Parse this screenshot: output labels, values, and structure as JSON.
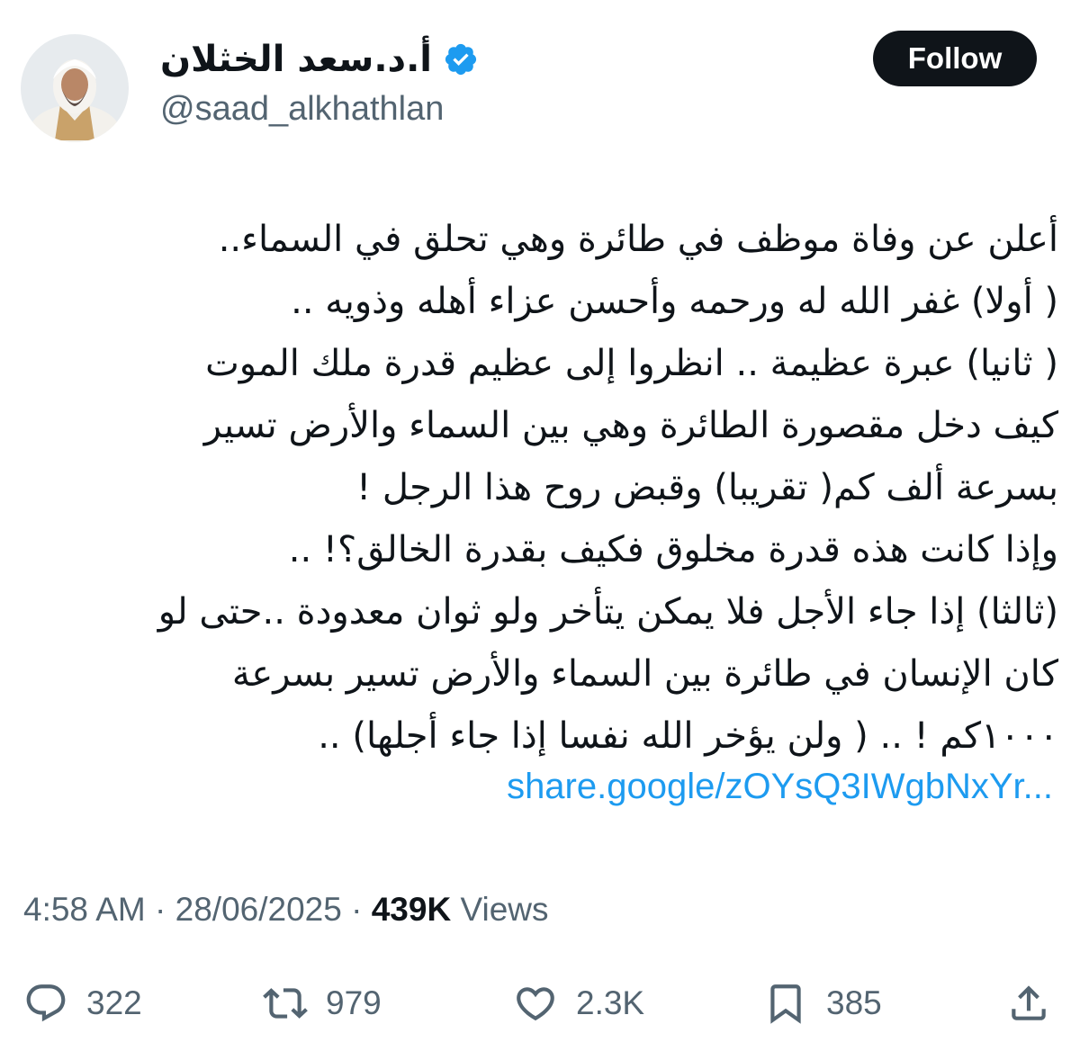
{
  "author": {
    "display_name": "أ.د.سعد الخثلان",
    "handle": "@saad_alkhathlan",
    "verified": true
  },
  "follow_button_label": "Follow",
  "tweet": {
    "lines": [
      "أعلن عن وفاة موظف في طائرة وهي تحلق في السماء..",
      "( أولا) غفر الله له ورحمه وأحسن عزاء أهله وذويه ..",
      "( ثانيا) عبرة عظيمة .. انظروا إلى عظيم قدرة ملك الموت",
      "كيف دخل مقصورة الطائرة وهي بين السماء والأرض تسير",
      "بسرعة ألف كم( تقريبا)  وقبض روح هذا الرجل !",
      "وإذا كانت هذه قدرة مخلوق فكيف بقدرة الخالق؟! ..",
      "(ثالثا) إذا جاء الأجل فلا يمكن يتأخر ولو ثوان معدودة ..حتى لو",
      "كان الإنسان في طائرة بين السماء والأرض تسير بسرعة",
      "١٠٠٠كم !  .. ( ولن يؤخر الله نفسا إذا جاء أجلها) .."
    ],
    "link": "share.google/zOYsQ3IWgbNxYr..."
  },
  "meta": {
    "time": "4:58 AM",
    "separator": " · ",
    "date": "28/06/2025",
    "views_count": "439K",
    "views_label": " Views"
  },
  "actions": {
    "reply": {
      "icon": "reply-icon",
      "count": "322"
    },
    "retweet": {
      "icon": "retweet-icon",
      "count": "979"
    },
    "like": {
      "icon": "heart-icon",
      "count": "2.3K"
    },
    "bookmark": {
      "icon": "bookmark-icon",
      "count": "385"
    },
    "share": {
      "icon": "share-icon"
    }
  },
  "colors": {
    "text": "#0f1419",
    "secondary": "#536471",
    "link": "#1d9bf0",
    "verified": "#1d9bf0",
    "follow_bg": "#0f1419"
  }
}
